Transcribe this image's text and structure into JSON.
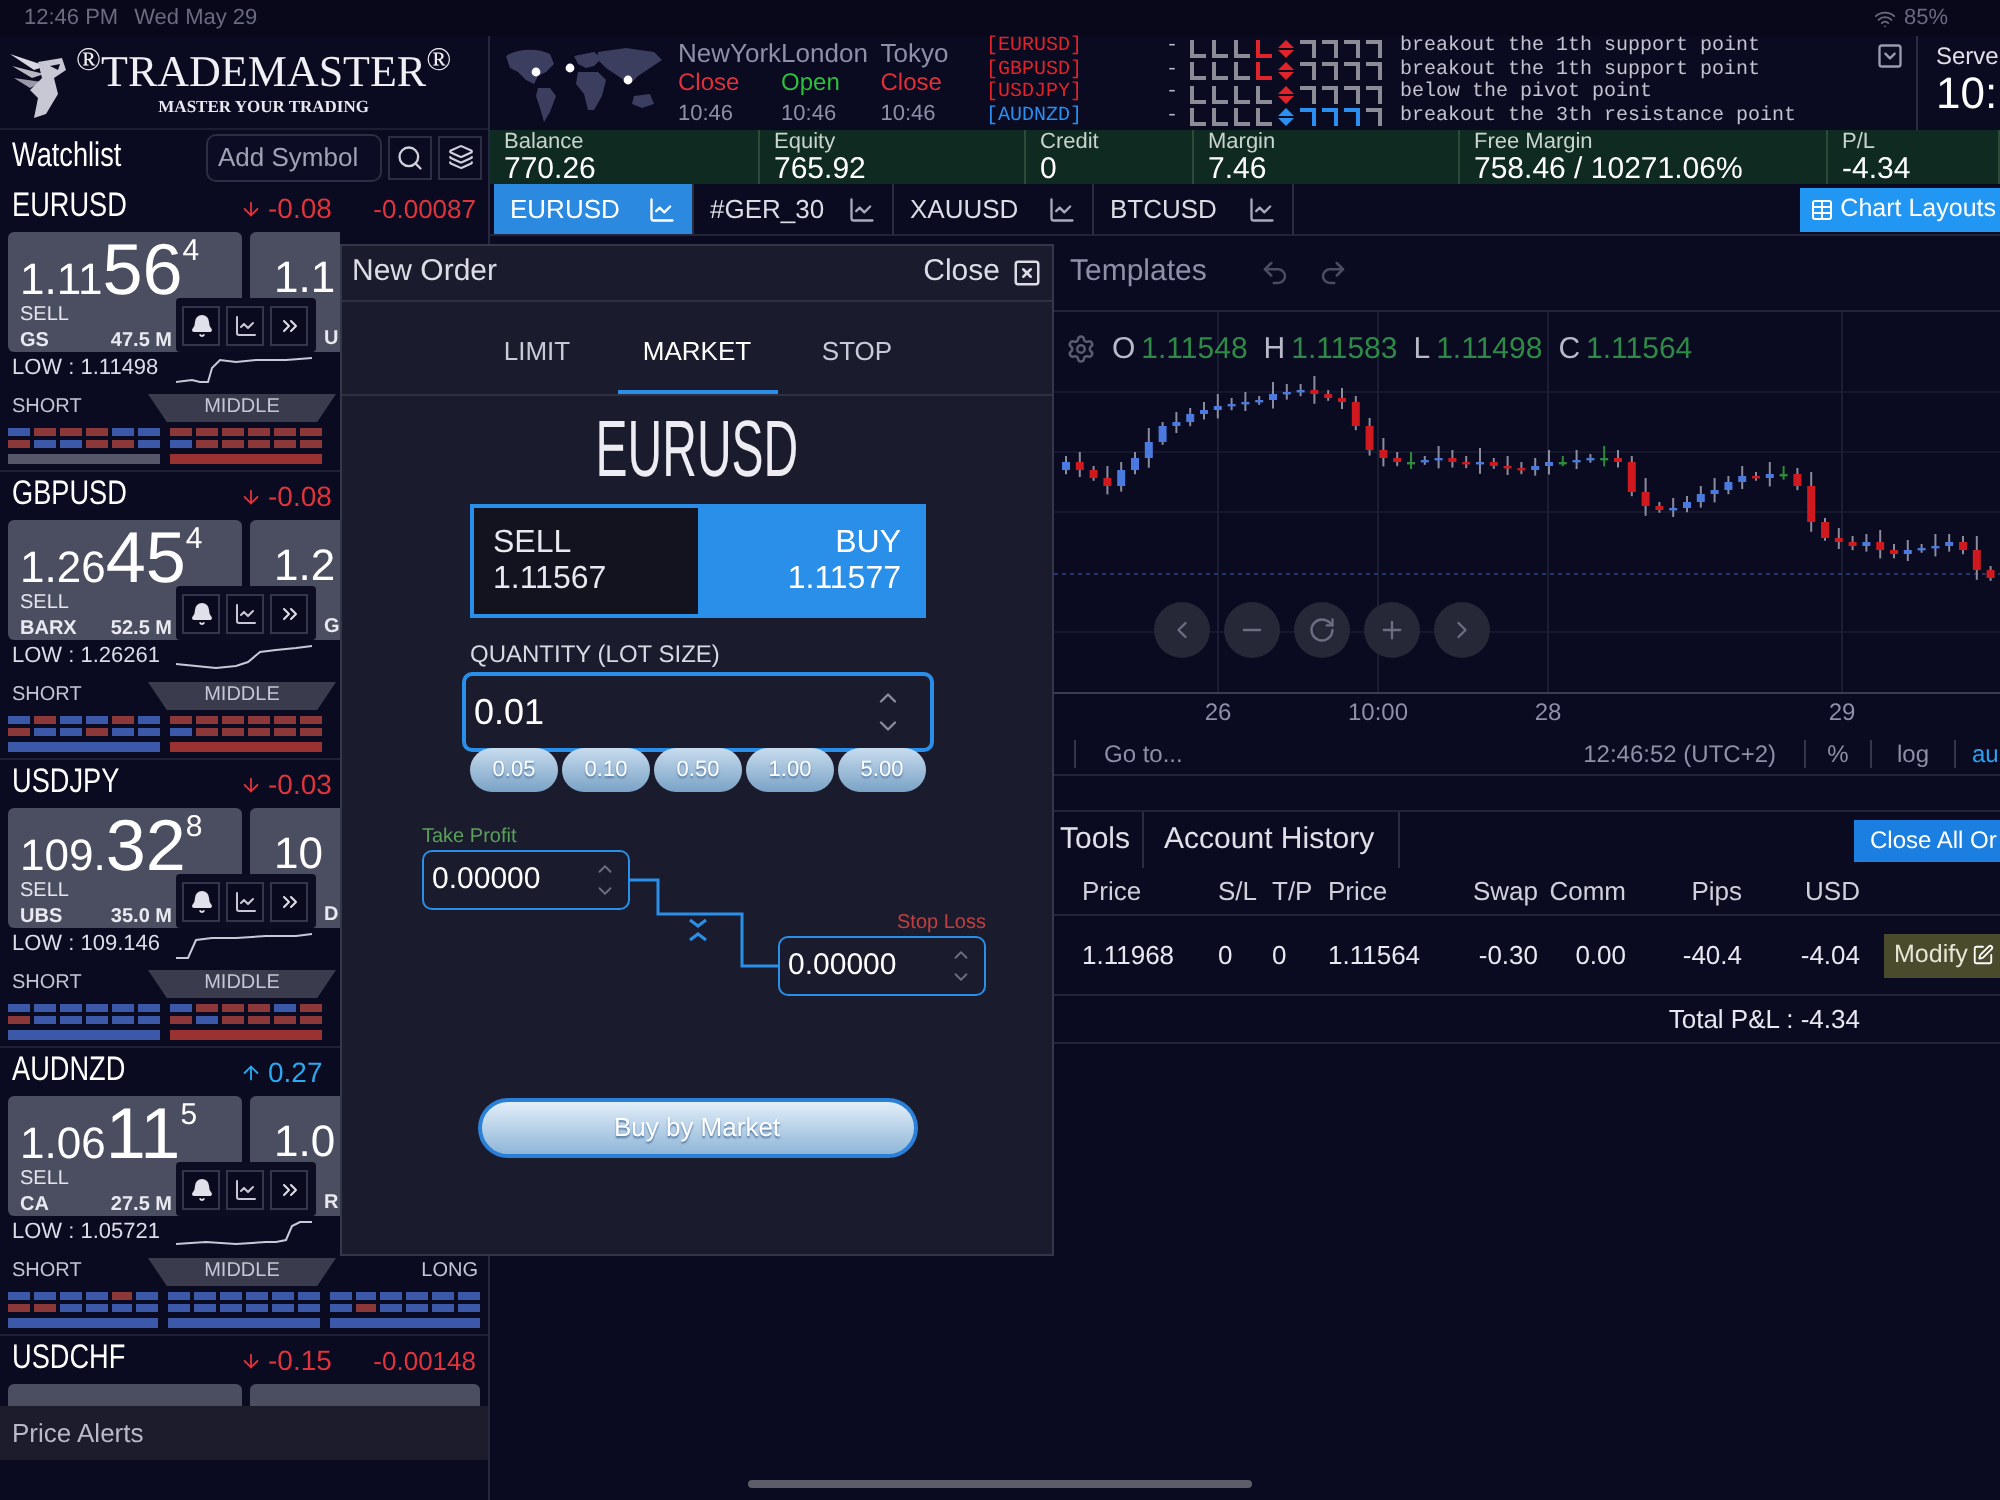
{
  "status_bar": {
    "time": "12:46 PM",
    "date": "Wed May 29",
    "battery": "85%"
  },
  "logo": {
    "name": "$^{®}$TRADEMASTER$^{®}$",
    "tagline": "MASTER YOUR TRADING"
  },
  "markets": [
    {
      "city": "NewYork",
      "status": "Close",
      "open": false,
      "time": "10:46"
    },
    {
      "city": "London",
      "status": "Open",
      "open": true,
      "time": "10:46"
    },
    {
      "city": "Tokyo",
      "status": "Close",
      "open": false,
      "time": "10:46"
    }
  ],
  "signals": [
    {
      "symbol": "[EURUSD]",
      "color": "#e0242a",
      "dash": "-",
      "indicator": [
        {
          "color": "#8c8c96"
        },
        {
          "color": "#8c8c96"
        },
        {
          "color": "#8c8c96"
        },
        {
          "color": "#e0242a"
        },
        {
          "color": "#e0242a"
        },
        {
          "color": "#8c8c96"
        },
        {
          "color": "#8c8c96"
        },
        {
          "color": "#8c8c96"
        },
        {
          "color": "#8c8c96"
        }
      ],
      "message": "breakout the 1th support point"
    },
    {
      "symbol": "[GBPUSD]",
      "color": "#e0242a",
      "dash": "-",
      "indicator": [
        {
          "color": "#8c8c96"
        },
        {
          "color": "#8c8c96"
        },
        {
          "color": "#8c8c96"
        },
        {
          "color": "#e0242a"
        },
        {
          "color": "#e0242a"
        },
        {
          "color": "#8c8c96"
        },
        {
          "color": "#8c8c96"
        },
        {
          "color": "#8c8c96"
        },
        {
          "color": "#8c8c96"
        }
      ],
      "message": "breakout the 1th support point"
    },
    {
      "symbol": "[USDJPY]",
      "color": "#e0242a",
      "dash": "-",
      "indicator": [
        {
          "color": "#8c8c96"
        },
        {
          "color": "#8c8c96"
        },
        {
          "color": "#8c8c96"
        },
        {
          "color": "#8c8c96"
        },
        {
          "color": "#e0242a"
        },
        {
          "color": "#8c8c96"
        },
        {
          "color": "#8c8c96"
        },
        {
          "color": "#8c8c96"
        },
        {
          "color": "#8c8c96"
        }
      ],
      "message": "below the pivot point"
    },
    {
      "symbol": "[AUDNZD]",
      "color": "#2a8ff0",
      "dash": "-",
      "indicator": [
        {
          "color": "#8c8c96"
        },
        {
          "color": "#8c8c96"
        },
        {
          "color": "#8c8c96"
        },
        {
          "color": "#8c8c96"
        },
        {
          "color": "#2a8ff0"
        },
        {
          "color": "#2a8ff0"
        },
        {
          "color": "#2a8ff0"
        },
        {
          "color": "#2a8ff0"
        },
        {
          "color": "#8c8c96"
        }
      ],
      "message": "breakout the 3th resistance point"
    }
  ],
  "server": {
    "label": "Serve",
    "time": "10:"
  },
  "watchlist": {
    "title": "Watchlist",
    "search": {
      "placeholder": "Add Symbol"
    },
    "cards": [
      {
        "symbol": "EURUSD",
        "kind": "down",
        "change": "-0.08",
        "delta": "-0.00087",
        "sell": {
          "price": "1.11",
          "pips": "56",
          "fraction": "4",
          "label": "SELL",
          "provider": "GS",
          "volume": "47.5 M"
        },
        "buy": {
          "price": "1.1",
          "provider": "U"
        },
        "low": "LOW : 1.11498",
        "sentiment": {
          "labels": [
            "SHORT",
            "MIDDLE"
          ],
          "groups": [
            {
              "top": [
                {
                  "color": "#3c58a8"
                },
                {
                  "color": "#8c3838"
                },
                {
                  "color": "#8c3838"
                },
                {
                  "color": "#8c3838"
                },
                {
                  "color": "#3c58a8"
                },
                {
                  "color": "#3c58a8"
                }
              ],
              "bottom": [
                {
                  "color": "#8c3838"
                },
                {
                  "color": "#3c58a8"
                },
                {
                  "color": "#3c58a8"
                },
                {
                  "color": "#8c3838"
                },
                {
                  "color": "#8c3838"
                },
                {
                  "color": "#3c58a8"
                }
              ],
              "bar": {
                "color": "#56586a"
              }
            },
            {
              "top": [
                {
                  "color": "#8c3838"
                },
                {
                  "color": "#8c3838"
                },
                {
                  "color": "#8c3838"
                },
                {
                  "color": "#8c3838"
                },
                {
                  "color": "#8c3838"
                },
                {
                  "color": "#8c3838"
                }
              ],
              "bottom": [
                {
                  "color": "#3c58a8"
                },
                {
                  "color": "#8c3838"
                },
                {
                  "color": "#8c3838"
                },
                {
                  "color": "#8c3838"
                },
                {
                  "color": "#8c3838"
                },
                {
                  "color": "#8c3838"
                }
              ],
              "bar": {
                "color": "#9a3232"
              }
            }
          ]
        }
      },
      {
        "symbol": "GBPUSD",
        "kind": "down",
        "change": "-0.08",
        "sell": {
          "price": "1.26",
          "pips": "45",
          "fraction": "4",
          "label": "SELL",
          "provider": "BARX",
          "volume": "52.5 M"
        },
        "buy": {
          "price": "1.2",
          "provider": "G"
        },
        "low": "LOW : 1.26261",
        "sentiment": {
          "labels": [
            "SHORT",
            "MIDDLE"
          ],
          "groups": [
            {
              "top": [
                {
                  "color": "#3c58a8"
                },
                {
                  "color": "#8c3838"
                },
                {
                  "color": "#3c58a8"
                },
                {
                  "color": "#3c58a8"
                },
                {
                  "color": "#8c3838"
                },
                {
                  "color": "#3c58a8"
                }
              ],
              "bottom": [
                {
                  "color": "#8c3838"
                },
                {
                  "color": "#3c58a8"
                },
                {
                  "color": "#3c58a8"
                },
                {
                  "color": "#8c3838"
                },
                {
                  "color": "#3c58a8"
                },
                {
                  "color": "#3c58a8"
                }
              ],
              "bar": {
                "color": "#3c58a8"
              }
            },
            {
              "top": [
                {
                  "color": "#8c3838"
                },
                {
                  "color": "#8c3838"
                },
                {
                  "color": "#8c3838"
                },
                {
                  "color": "#8c3838"
                },
                {
                  "color": "#8c3838"
                },
                {
                  "color": "#8c3838"
                }
              ],
              "bottom": [
                {
                  "color": "#3c58a8"
                },
                {
                  "color": "#8c3838"
                },
                {
                  "color": "#8c3838"
                },
                {
                  "color": "#8c3838"
                },
                {
                  "color": "#8c3838"
                },
                {
                  "color": "#8c3838"
                }
              ],
              "bar": {
                "color": "#9a3232"
              }
            }
          ]
        }
      },
      {
        "symbol": "USDJPY",
        "kind": "down",
        "change": "-0.03",
        "sell": {
          "price": "109.",
          "pips": "32",
          "fraction": "8",
          "label": "SELL",
          "provider": "UBS",
          "volume": "35.0 M"
        },
        "buy": {
          "price": "10",
          "provider": "D"
        },
        "low": "LOW : 109.146",
        "sentiment": {
          "labels": [
            "SHORT",
            "MIDDLE"
          ],
          "groups": [
            {
              "top": [
                {
                  "color": "#3c58a8"
                },
                {
                  "color": "#3c58a8"
                },
                {
                  "color": "#3c58a8"
                },
                {
                  "color": "#3c58a8"
                },
                {
                  "color": "#3c58a8"
                },
                {
                  "color": "#3c58a8"
                }
              ],
              "bottom": [
                {
                  "color": "#8c3838"
                },
                {
                  "color": "#3c58a8"
                },
                {
                  "color": "#3c58a8"
                },
                {
                  "color": "#3c58a8"
                },
                {
                  "color": "#3c58a8"
                },
                {
                  "color": "#3c58a8"
                }
              ],
              "bar": {
                "color": "#3c58a8"
              }
            },
            {
              "top": [
                {
                  "color": "#3c58a8"
                },
                {
                  "color": "#8c3838"
                },
                {
                  "color": "#8c3838"
                },
                {
                  "color": "#8c3838"
                },
                {
                  "color": "#3c58a8"
                },
                {
                  "color": "#8c3838"
                }
              ],
              "bottom": [
                {
                  "color": "#8c3838"
                },
                {
                  "color": "#3c58a8"
                },
                {
                  "color": "#8c3838"
                },
                {
                  "color": "#8c3838"
                },
                {
                  "color": "#8c3838"
                },
                {
                  "color": "#8c3838"
                }
              ],
              "bar": {
                "color": "#9a3232"
              }
            }
          ]
        }
      },
      {
        "symbol": "AUDNZD",
        "kind": "up",
        "change": "0.27",
        "sell": {
          "price": "1.06",
          "pips": "11",
          "fraction": "5",
          "label": "SELL",
          "provider": "CA",
          "volume": "27.5 M"
        },
        "buy": {
          "price": "1.0",
          "provider": "R"
        },
        "low": "LOW : 1.05721",
        "sentiment": {
          "labels": [
            "SHORT",
            "MIDDLE",
            "LONG"
          ],
          "groups": [
            {
              "top": [
                {
                  "color": "#3c58a8"
                },
                {
                  "color": "#3c58a8"
                },
                {
                  "color": "#3c58a8"
                },
                {
                  "color": "#3c58a8"
                },
                {
                  "color": "#8c3838"
                },
                {
                  "color": "#3c58a8"
                }
              ],
              "bottom": [
                {
                  "color": "#8c3838"
                },
                {
                  "color": "#8c3838"
                },
                {
                  "color": "#3c58a8"
                },
                {
                  "color": "#3c58a8"
                },
                {
                  "color": "#3c58a8"
                },
                {
                  "color": "#3c58a8"
                }
              ],
              "bar": {
                "color": "#3c58a8"
              }
            },
            {
              "top": [
                {
                  "color": "#3c58a8"
                },
                {
                  "color": "#3c58a8"
                },
                {
                  "color": "#3c58a8"
                },
                {
                  "color": "#3c58a8"
                },
                {
                  "color": "#3c58a8"
                },
                {
                  "color": "#3c58a8"
                }
              ],
              "bottom": [
                {
                  "color": "#3c58a8"
                },
                {
                  "color": "#3c58a8"
                },
                {
                  "color": "#3c58a8"
                },
                {
                  "color": "#3c58a8"
                },
                {
                  "color": "#3c58a8"
                },
                {
                  "color": "#3c58a8"
                }
              ],
              "bar": {
                "color": "#3c58a8"
              }
            },
            {
              "top": [
                {
                  "color": "#3c58a8"
                },
                {
                  "color": "#3c58a8"
                },
                {
                  "color": "#3c58a8"
                },
                {
                  "color": "#3c58a8"
                },
                {
                  "color": "#3c58a8"
                },
                {
                  "color": "#3c58a8"
                }
              ],
              "bottom": [
                {
                  "color": "#3c58a8"
                },
                {
                  "color": "#8c3838"
                },
                {
                  "color": "#3c58a8"
                },
                {
                  "color": "#3c58a8"
                },
                {
                  "color": "#3c58a8"
                },
                {
                  "color": "#3c58a8"
                }
              ],
              "bar": {
                "color": "#3c58a8"
              }
            }
          ]
        }
      },
      {
        "symbol": "USDCHF",
        "kind": "down",
        "change": "-0.15",
        "delta": "-0.00148"
      }
    ]
  },
  "price_alerts": "Price Alerts",
  "account": [
    {
      "label": "Balance",
      "value": "770.26"
    },
    {
      "label": "Equity",
      "value": "765.92"
    },
    {
      "label": "Credit",
      "value": "0"
    },
    {
      "label": "Margin",
      "value": "7.46"
    },
    {
      "label": "Free Margin",
      "value": "758.46 / 10271.06%"
    },
    {
      "label": "P/L",
      "value": "-4.34"
    }
  ],
  "chart_tabs": [
    {
      "label": "EURUSD",
      "selected": true
    },
    {
      "label": "#GER_30",
      "selected": false
    },
    {
      "label": "XAUUSD",
      "selected": false
    },
    {
      "label": "BTCUSD",
      "selected": false
    }
  ],
  "chart_layouts": "Chart Layouts",
  "chart": {
    "templates": "Templates",
    "legend": [
      {
        "key": "O",
        "value": "1.11548"
      },
      {
        "key": "H",
        "value": "1.11583"
      },
      {
        "key": "L",
        "value": "1.11498"
      },
      {
        "key": "C",
        "value": "1.11564"
      }
    ],
    "x_labels": [
      "26",
      "10:00",
      "28",
      "29"
    ],
    "goto": "Go to...",
    "time": "12:46:52 (UTC+2)",
    "scale_options": [
      {
        "label": "%",
        "selected": false
      },
      {
        "label": "log",
        "selected": false
      },
      {
        "label": "au",
        "selected": true
      }
    ]
  },
  "bottom_panel": {
    "tabs": [
      {
        "label": "Tools",
        "selected": false
      },
      {
        "label": "Account History",
        "selected": false
      }
    ],
    "close_all": "Close All Or",
    "columns": [
      "Price",
      "S/L",
      "T/P",
      "Price",
      "Swap",
      "Comm",
      "Pips",
      "USD"
    ],
    "rows": [
      {
        "cells": [
          "1.11968",
          "0",
          "0",
          "1.11564",
          "-0.30",
          "0.00",
          "-40.4",
          "-4.04"
        ],
        "action": "Modify"
      }
    ],
    "total": "Total P&L : -4.34"
  },
  "order_dialog": {
    "title": "New Order",
    "close": "Close",
    "tabs": [
      {
        "label": "LIMIT",
        "selected": false
      },
      {
        "label": "MARKET",
        "selected": true
      },
      {
        "label": "STOP",
        "selected": false
      }
    ],
    "symbol": "EURUSD",
    "sides": [
      {
        "label": "SELL",
        "price": "1.11567",
        "selected": false
      },
      {
        "label": "BUY",
        "price": "1.11577",
        "selected": true
      }
    ],
    "quantity": {
      "label": "QUANTITY (LOT SIZE)",
      "value": "0.01",
      "presets": [
        "0.05",
        "0.10",
        "0.50",
        "1.00",
        "5.00"
      ]
    },
    "take_profit": {
      "label": "Take Profit",
      "value": "0.00000"
    },
    "stop_loss": {
      "label": "Stop Loss",
      "value": "0.00000"
    },
    "submit": "Buy by Market"
  }
}
